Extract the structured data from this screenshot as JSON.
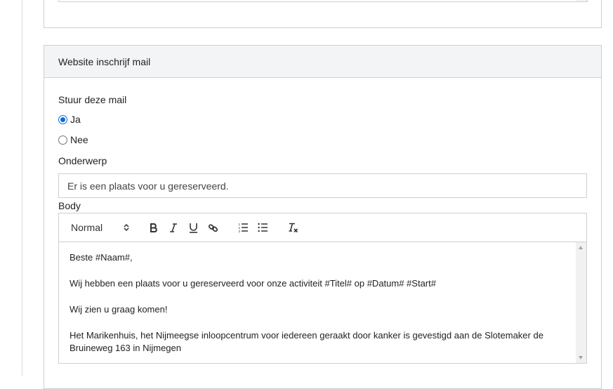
{
  "section": {
    "title": "Website inschrijf mail"
  },
  "send_mail": {
    "label": "Stuur deze mail",
    "options": [
      {
        "label": "Ja",
        "checked": true
      },
      {
        "label": "Nee",
        "checked": false
      }
    ]
  },
  "subject": {
    "label": "Onderwerp",
    "value": "Er is een plaats voor u gereserveerd."
  },
  "body": {
    "label": "Body",
    "toolbar": {
      "format_select": "Normal",
      "icons": [
        "bold-icon",
        "italic-icon",
        "underline-icon",
        "link-icon",
        "ordered-list-icon",
        "bullet-list-icon",
        "clear-format-icon"
      ]
    },
    "paragraphs": [
      "Beste #Naam#,",
      "Wij hebben een plaats voor u gereserveerd voor onze activiteit #Titel# op #Datum# #Start#",
      "Wij zien u graag komen!",
      "Het Marikenhuis, het Nijmeegse inloopcentrum voor iedereen geraakt door kanker is gevestigd aan de Slotemaker de Bruineweg 163 in Nijmegen"
    ]
  },
  "colors": {
    "radio_accent": "#0b6bd8",
    "header_bg": "#f3f4f6",
    "border": "#d0d0d0"
  }
}
